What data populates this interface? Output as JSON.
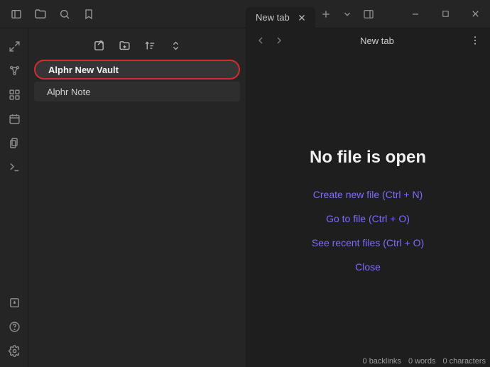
{
  "titlebar": {
    "tab_label": "New tab"
  },
  "editor": {
    "view_title": "New tab",
    "empty_heading": "No file is open",
    "actions": {
      "create": "Create new file (Ctrl + N)",
      "goto": "Go to file (Ctrl + O)",
      "recent": "See recent files (Ctrl + O)",
      "close": "Close"
    }
  },
  "file_pane": {
    "items": [
      {
        "label": "Alphr New Vault"
      },
      {
        "label": "Alphr Note"
      }
    ]
  },
  "status": {
    "backlinks": "0 backlinks",
    "words": "0 words",
    "chars": "0 characters"
  }
}
